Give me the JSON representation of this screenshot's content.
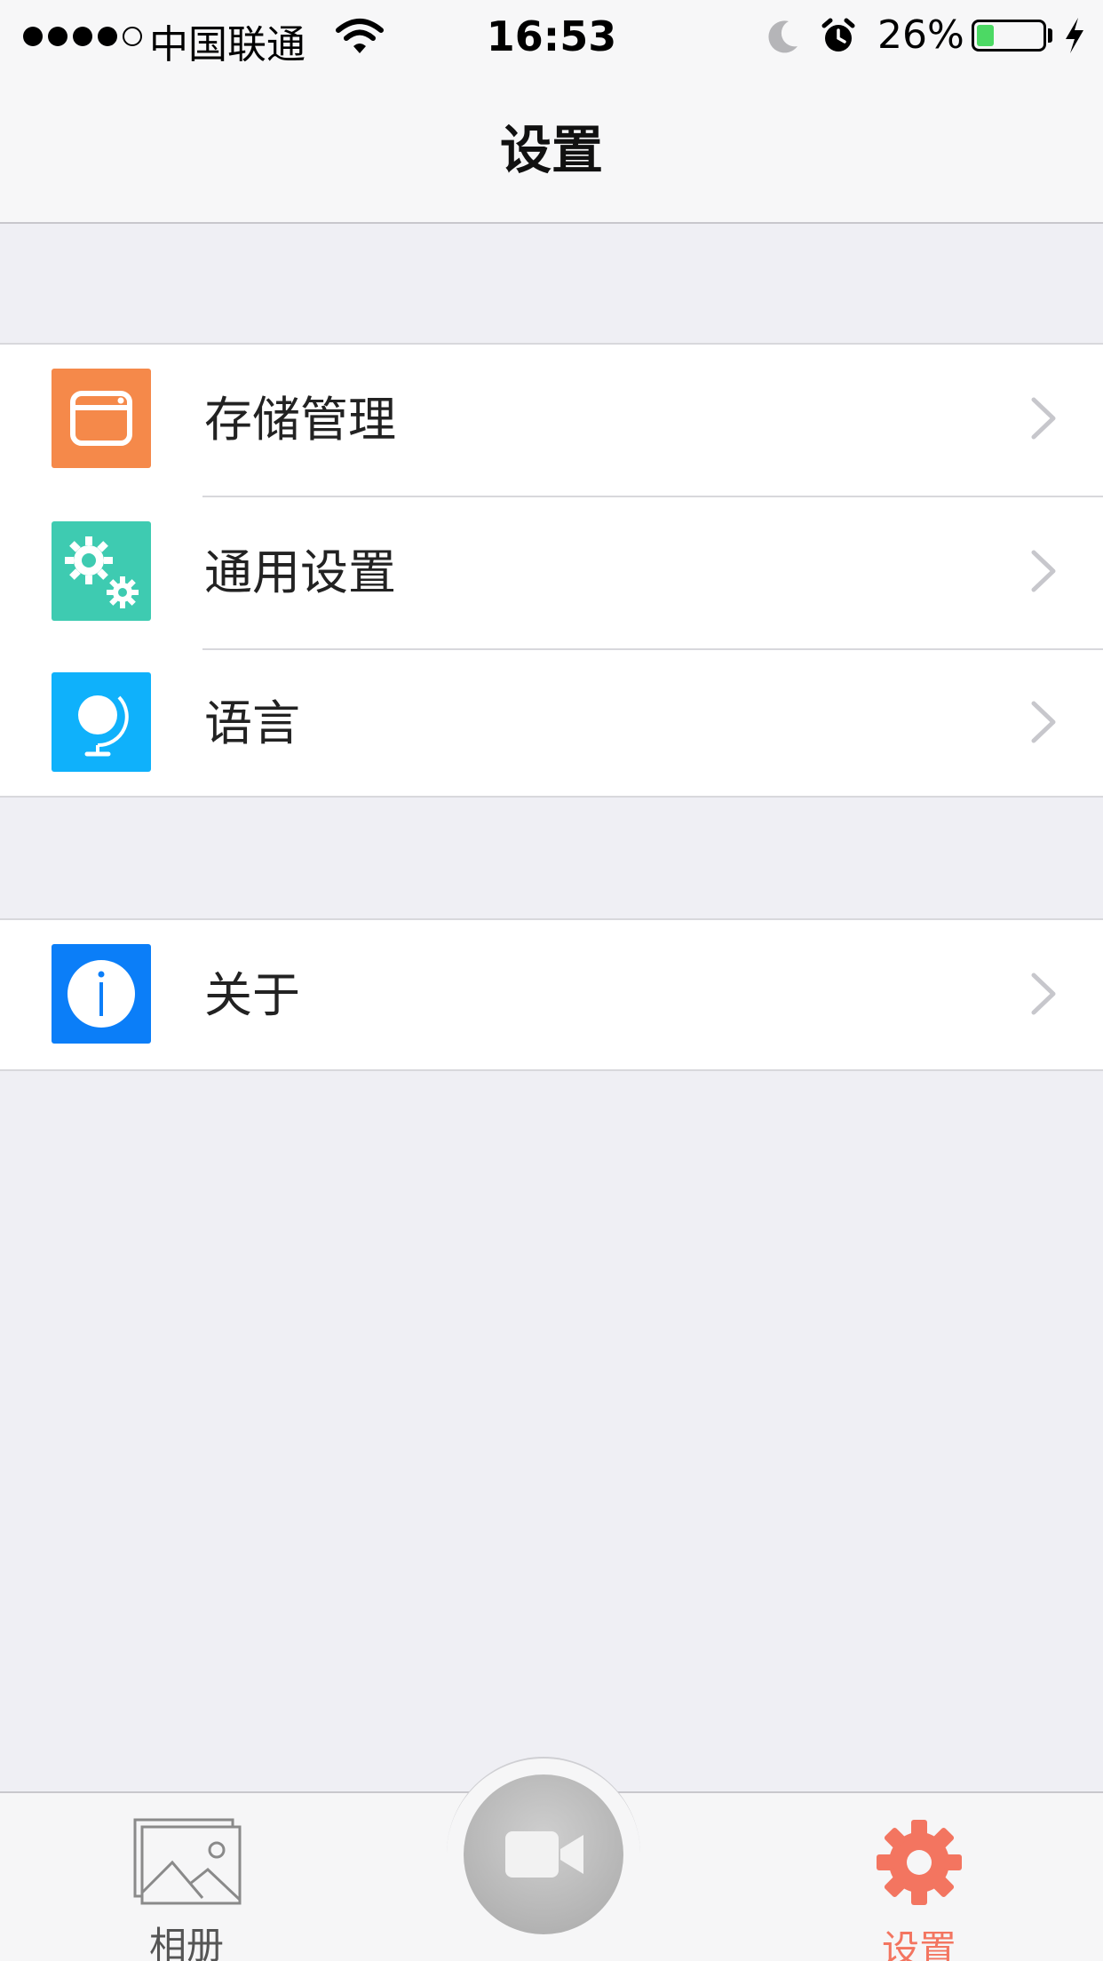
{
  "status_bar": {
    "carrier": "中国联通",
    "time": "16:53",
    "battery_percent_text": "26%",
    "battery_level": 0.26,
    "signal_bars": 4,
    "signal_max": 5
  },
  "nav": {
    "title": "设置"
  },
  "settings_group_1": {
    "items": [
      {
        "label": "存储管理",
        "icon": "storage-icon",
        "color": "#f5894a"
      },
      {
        "label": "通用设置",
        "icon": "gears-icon",
        "color": "#3ecbb1"
      },
      {
        "label": "语言",
        "icon": "globe-icon",
        "color": "#0fb1fb"
      }
    ]
  },
  "settings_group_2": {
    "items": [
      {
        "label": "关于",
        "icon": "info-icon",
        "color": "#0b7ef8"
      }
    ]
  },
  "tabbar": {
    "album_label": "相册",
    "settings_label": "设置",
    "active_color": "#f37560",
    "record_icon": "video-camera-icon"
  }
}
